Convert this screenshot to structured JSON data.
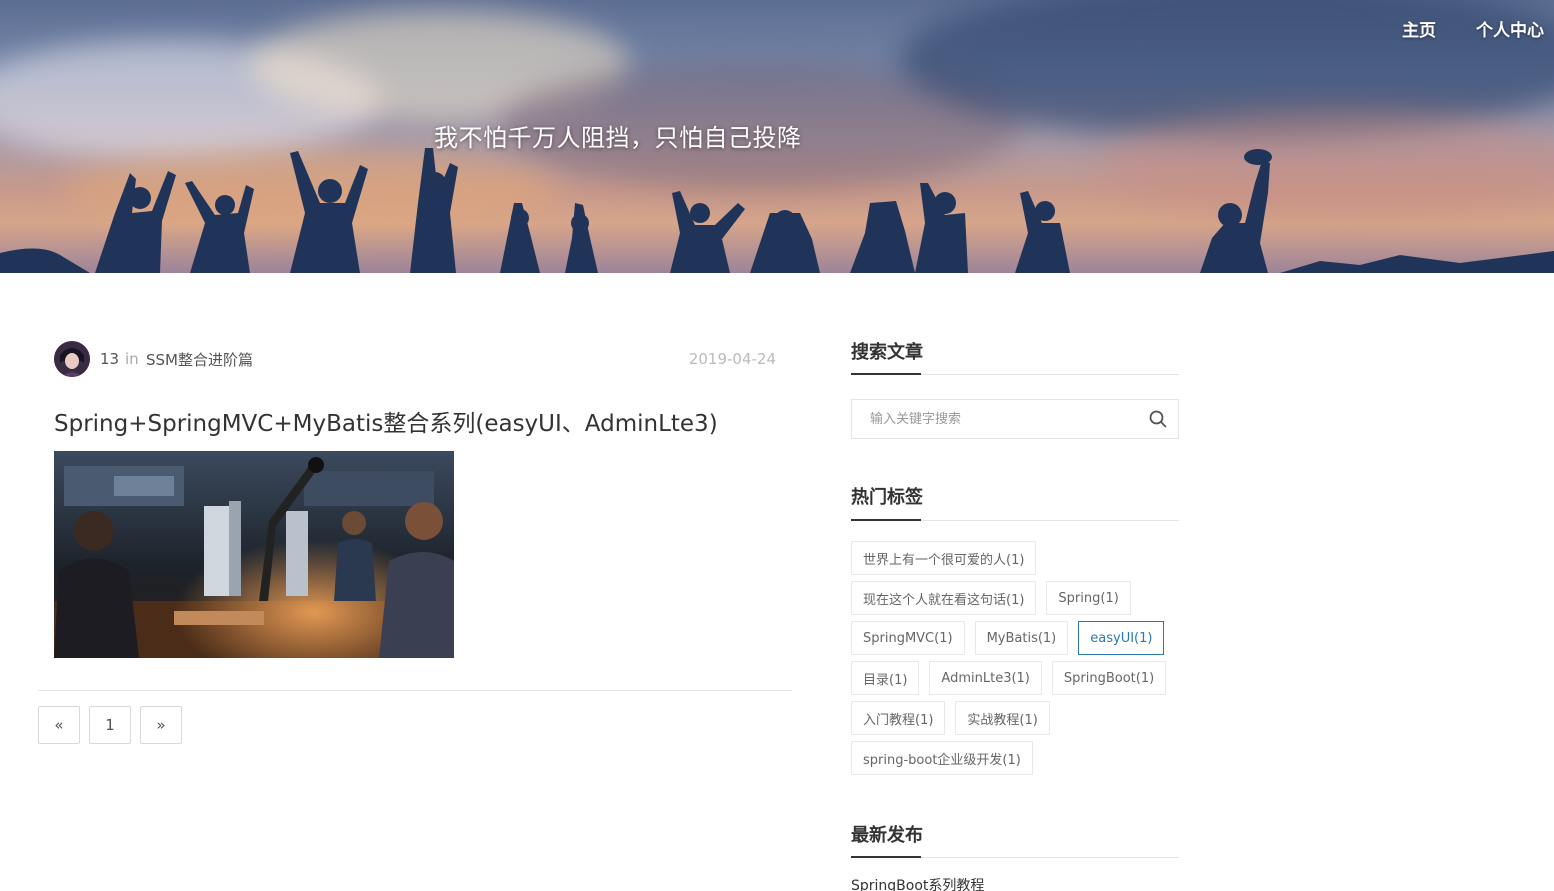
{
  "nav": {
    "home": "主页",
    "profile": "个人中心"
  },
  "hero": {
    "motto": "我不怕千万人阻挡，只怕自己投降"
  },
  "post": {
    "author": "13",
    "in_word": "in",
    "category": "SSM整合进阶篇",
    "date": "2019-04-24",
    "title": "Spring+SpringMVC+MyBatis整合系列(easyUI、AdminLte3)"
  },
  "pagination": {
    "prev": "«",
    "page": "1",
    "next": "»"
  },
  "sidebar": {
    "search": {
      "title": "搜索文章",
      "placeholder": "输入关键字搜索"
    },
    "tags": {
      "title": "热门标签",
      "rows": [
        [
          {
            "label": "世界上有一个很可爱的人(1)",
            "active": false
          }
        ],
        [
          {
            "label": "现在这个人就在看这句话(1)",
            "active": false
          },
          {
            "label": "Spring(1)",
            "active": false
          }
        ],
        [
          {
            "label": "SpringMVC(1)",
            "active": false
          },
          {
            "label": "MyBatis(1)",
            "active": false
          },
          {
            "label": "easyUI(1)",
            "active": true
          }
        ],
        [
          {
            "label": "目录(1)",
            "active": false
          },
          {
            "label": "AdminLte3(1)",
            "active": false
          },
          {
            "label": "SpringBoot(1)",
            "active": false
          }
        ],
        [
          {
            "label": "入门教程(1)",
            "active": false
          },
          {
            "label": "实战教程(1)",
            "active": false
          }
        ],
        [
          {
            "label": "spring-boot企业级开发(1)",
            "active": false
          }
        ]
      ]
    },
    "latest": {
      "title": "最新发布",
      "items": [
        "SpringBoot系列教程"
      ]
    }
  },
  "colors": {
    "accent": "#2a7ab0",
    "text": "#333333",
    "muted": "#bbbbbb",
    "border": "#e4e4e4"
  }
}
